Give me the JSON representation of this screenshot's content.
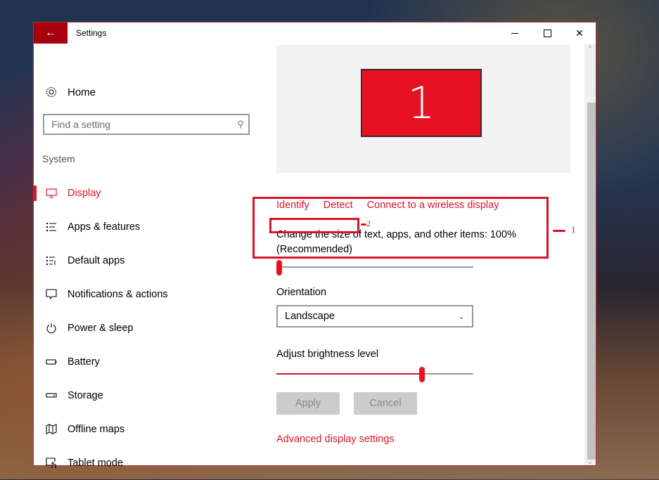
{
  "window": {
    "title": "Settings",
    "accent_color": "#e81123",
    "titlebar_back_color": "#a8000f"
  },
  "sidebar": {
    "home_label": "Home",
    "search_placeholder": "Find a setting",
    "section_label": "System",
    "items": [
      {
        "label": "Display",
        "icon": "monitor-icon",
        "active": true
      },
      {
        "label": "Apps & features",
        "icon": "apps-list-icon",
        "active": false
      },
      {
        "label": "Default apps",
        "icon": "default-apps-icon",
        "active": false
      },
      {
        "label": "Notifications & actions",
        "icon": "notification-icon",
        "active": false
      },
      {
        "label": "Power & sleep",
        "icon": "power-icon",
        "active": false
      },
      {
        "label": "Battery",
        "icon": "battery-icon",
        "active": false
      },
      {
        "label": "Storage",
        "icon": "storage-icon",
        "active": false
      },
      {
        "label": "Offline maps",
        "icon": "map-icon",
        "active": false
      },
      {
        "label": "Tablet mode",
        "icon": "tablet-mode-icon",
        "active": false
      }
    ]
  },
  "content": {
    "monitor_number": "1",
    "links": {
      "identify": "Identify",
      "detect": "Detect",
      "wireless": "Connect to a wireless display"
    },
    "scale_text": "Change the size of text, apps, and other items: 100% (Recommended)",
    "scale_slider_fraction": 0.0,
    "orientation_label": "Orientation",
    "orientation_value": "Landscape",
    "brightness_label": "Adjust brightness level",
    "brightness_fraction": 0.74,
    "apply_label": "Apply",
    "cancel_label": "Cancel",
    "advanced_link": "Advanced display settings"
  },
  "annotations": {
    "label1": "1",
    "label2": "2"
  }
}
